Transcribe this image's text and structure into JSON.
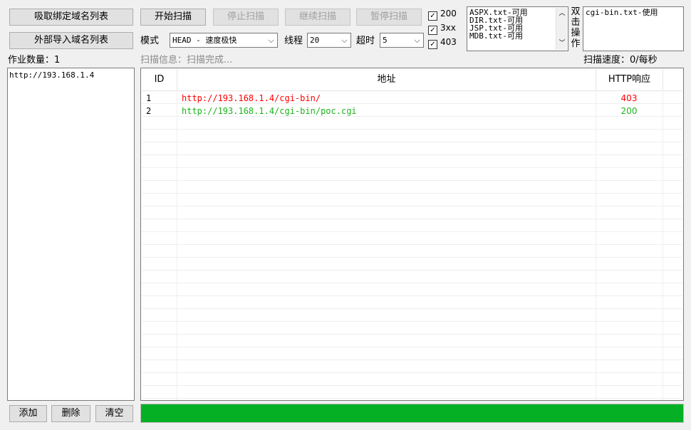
{
  "left": {
    "btn_fetch_bound": "吸取绑定域名列表",
    "btn_import": "外部导入域名列表",
    "job_count_label": "作业数量：1",
    "domains": [
      "http://193.168.1.4"
    ],
    "btn_add": "添加",
    "btn_delete": "删除",
    "btn_clear": "清空"
  },
  "toolbar": {
    "start": "开始扫描",
    "stop": "停止扫描",
    "resume": "继续扫描",
    "pause": "暂停扫描",
    "mode_label": "模式",
    "mode_value": "HEAD - 速度极快",
    "threads_label": "线程",
    "threads_value": "20",
    "timeout_label": "超时",
    "timeout_value": "5"
  },
  "filters": [
    {
      "label": "200",
      "checked": true
    },
    {
      "label": "3xx",
      "checked": true
    },
    {
      "label": "403",
      "checked": true
    }
  ],
  "dictionaries": [
    "ASPX.txt-可用",
    "DIR.txt-可用",
    "JSP.txt-可用",
    "MDB.txt-可用"
  ],
  "double_click_label": "双击操作",
  "selected_dicts": [
    "cgi-bin.txt-使用"
  ],
  "status": {
    "info": "扫描信息：扫描完成...",
    "speed": "扫描速度：0/每秒"
  },
  "table": {
    "columns": [
      "ID",
      "地址",
      "HTTP响应"
    ],
    "rows": [
      {
        "id": "1",
        "url": "http://193.168.1.4/cgi-bin/",
        "code": "403",
        "color": "#ff0000"
      },
      {
        "id": "2",
        "url": "http://193.168.1.4/cgi-bin/poc.cgi",
        "code": "200",
        "color": "#1db41d"
      }
    ]
  },
  "progress": {
    "fraction": 1.0,
    "color": "#06b025"
  }
}
